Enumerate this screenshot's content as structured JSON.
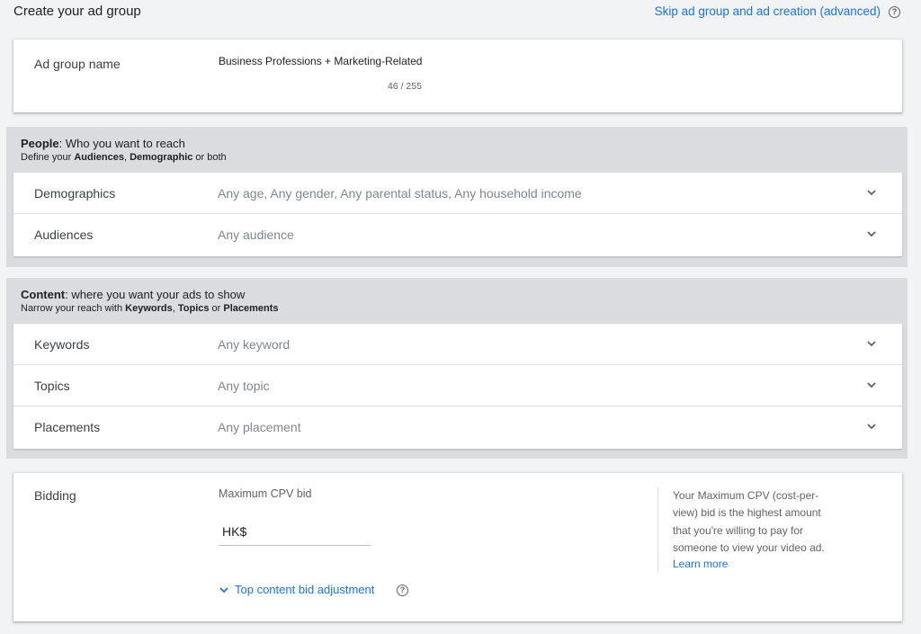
{
  "header": {
    "title": "Create your ad group",
    "skip_link": "Skip ad group and ad creation (advanced)",
    "help_glyph": "?"
  },
  "ad_group": {
    "label": "Ad group name",
    "value": "Business Professions + Marketing-Related",
    "char_count": "46 / 255"
  },
  "people": {
    "title_bold": "People",
    "title_rest": ": Who you want to reach",
    "sub_prefix": "Define your ",
    "sub_bold1": "Audiences",
    "sub_sep": ", ",
    "sub_bold2": "Demographic",
    "sub_suffix": " or both",
    "rows": [
      {
        "label": "Demographics",
        "value": "Any age, Any gender, Any parental status, Any household income"
      },
      {
        "label": "Audiences",
        "value": "Any audience"
      }
    ]
  },
  "content": {
    "title_bold": "Content",
    "title_rest": ": where you want your ads to show",
    "sub_prefix": "Narrow your reach with ",
    "sub_bold1": "Keywords",
    "sub_sep": ", ",
    "sub_bold2": "Topics",
    "sub_mid": " or ",
    "sub_bold3": "Placements",
    "rows": [
      {
        "label": "Keywords",
        "value": "Any keyword"
      },
      {
        "label": "Topics",
        "value": "Any topic"
      },
      {
        "label": "Placements",
        "value": "Any placement"
      }
    ]
  },
  "bidding": {
    "label": "Bidding",
    "max_cpv_label": "Maximum CPV bid",
    "currency": "HK$",
    "bid_value": "",
    "top_content_link": "Top content bid adjustment",
    "help_text": "Your Maximum CPV (cost-per-view) bid is the highest amount that you're willing to pay for someone to view your video ad.",
    "learn_more": "Learn more"
  },
  "colors": {
    "link": "#1a73e8",
    "section_bg": "#dadce0",
    "page_bg": "#f1f3f4"
  },
  "icons": {
    "help": "help-circle-icon",
    "chevron": "chevron-down-icon"
  }
}
